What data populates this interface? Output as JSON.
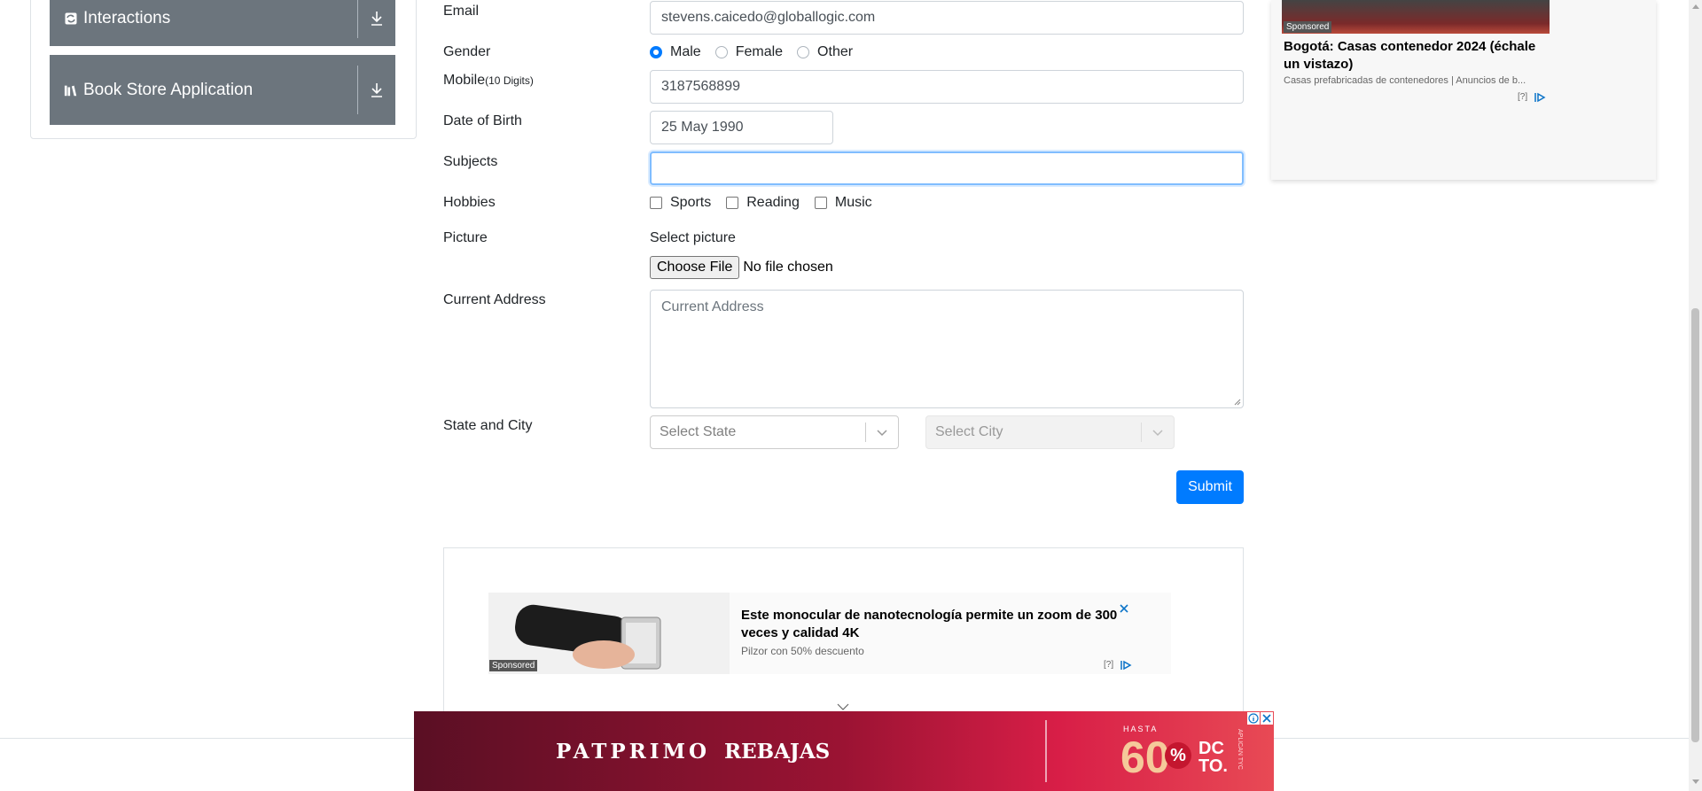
{
  "sidebar": {
    "groups": [
      {
        "title": "Interactions",
        "icon": "interactions-icon"
      },
      {
        "title": "Book Store Application",
        "icon": "book-store-icon"
      }
    ]
  },
  "form": {
    "email": {
      "label": "Email",
      "value": "stevens.caicedo@globallogic.com"
    },
    "gender": {
      "label": "Gender",
      "options": [
        "Male",
        "Female",
        "Other"
      ],
      "selected": "Male"
    },
    "mobile": {
      "label": "Mobile",
      "hint": "(10 Digits)",
      "value": "3187568899"
    },
    "dob": {
      "label": "Date of Birth",
      "value": "25 May 1990"
    },
    "subjects": {
      "label": "Subjects",
      "value": ""
    },
    "hobbies": {
      "label": "Hobbies",
      "options": [
        "Sports",
        "Reading",
        "Music"
      ]
    },
    "picture": {
      "label": "Picture",
      "caption": "Select picture",
      "button": "Choose File",
      "status": "No file chosen"
    },
    "address": {
      "label": "Current Address",
      "placeholder": "Current Address"
    },
    "state_city": {
      "label": "State and City",
      "state_placeholder": "Select State",
      "city_placeholder": "Select City"
    },
    "submit": "Submit"
  },
  "ads": {
    "side": {
      "sponsored": "Sponsored",
      "title": "Bogotá: Casas contenedor 2024 (échale un vistazo)",
      "source": "Casas prefabricadas de contenedores | Anuncios de b...",
      "help": "[?]"
    },
    "inline": {
      "sponsored": "Sponsored",
      "title": "Este monocular de nanotecnología permite un zoom de 300 veces y calidad 4K",
      "source": "Pilzor con 50% descuento",
      "help": "[?]"
    },
    "banner": {
      "brand": "PATPRIMO",
      "campaign": "REBAJAS",
      "upto": "HASTA",
      "percent": "60",
      "percent_sign": "%",
      "suffix1": "DC",
      "suffix2": "TO.",
      "legal": "APLICAN TYC"
    }
  },
  "colors": {
    "accent": "#007bff",
    "sidebar_group": "#6c757d",
    "banner_left": "#5a0f24",
    "banner_right": "#d81e47"
  }
}
